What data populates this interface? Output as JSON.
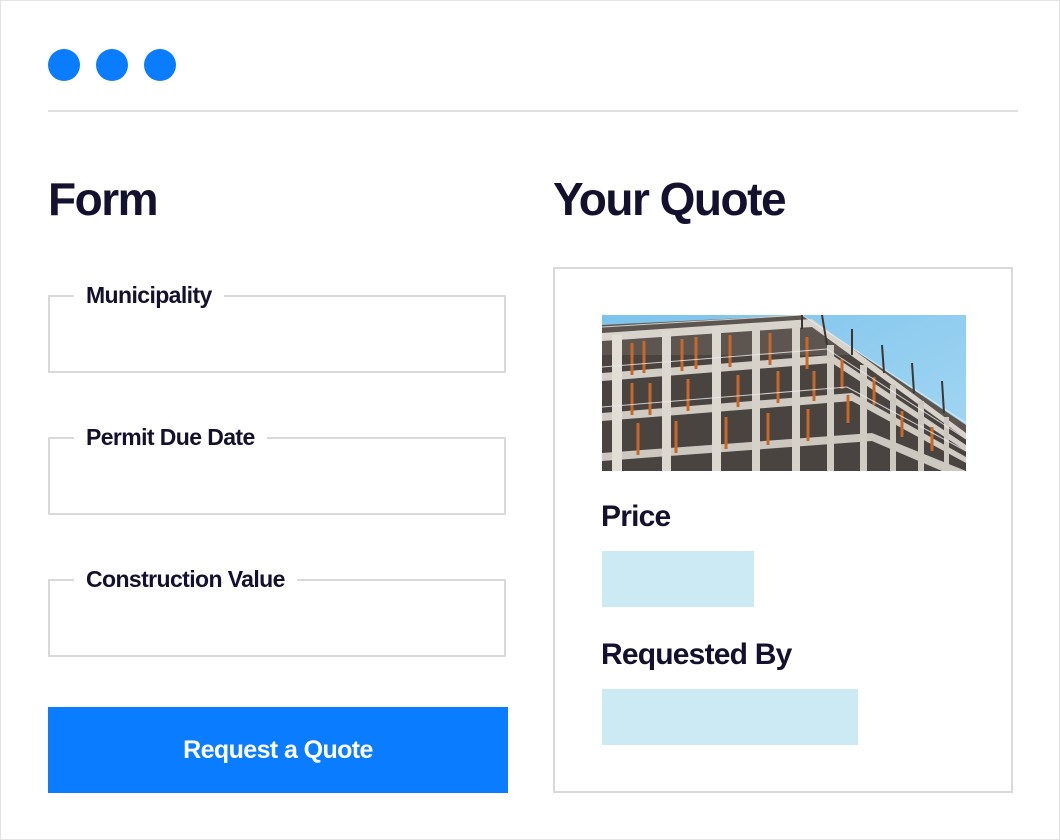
{
  "theme": {
    "accent": "#0a7cff",
    "window_dot": "#0a7cff",
    "placeholder_fill": "#cbeaf4",
    "text": "#13112e",
    "border": "#d9d9d9"
  },
  "window": {
    "dots": [
      "window-dot",
      "window-dot",
      "window-dot"
    ]
  },
  "form": {
    "title": "Form",
    "fields": [
      {
        "label": "Municipality",
        "value": ""
      },
      {
        "label": "Permit Due Date",
        "value": ""
      },
      {
        "label": "Construction Value",
        "value": ""
      }
    ],
    "submit_label": "Request a Quote"
  },
  "quote": {
    "title": "Your Quote",
    "image": "construction-site-photo",
    "price_label": "Price",
    "price_value": "",
    "requested_by_label": "Requested By",
    "requested_by_value": ""
  }
}
